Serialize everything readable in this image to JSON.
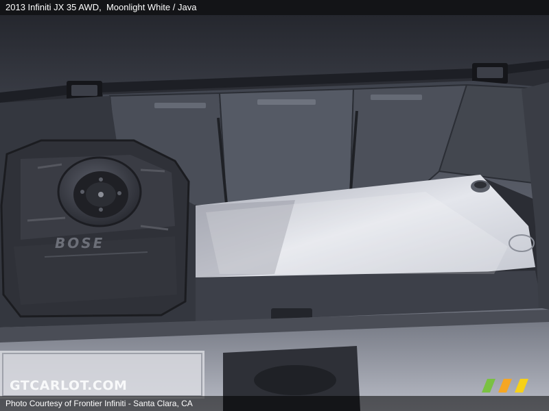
{
  "caption": {
    "title": "2013 Infiniti JX 35 AWD,",
    "color_text": "Moonlight White / Java"
  },
  "photo": {
    "subject_icon": "cargo-area-photo",
    "emblem_text": "BOSE"
  },
  "watermark": {
    "text": "GTCARLOT.COM",
    "logo_colors": [
      "#7ac142",
      "#f5a623",
      "#f7d117"
    ]
  },
  "credit": {
    "text": "Photo Courtesy of Frontier Infiniti - Santa Clara, CA"
  }
}
